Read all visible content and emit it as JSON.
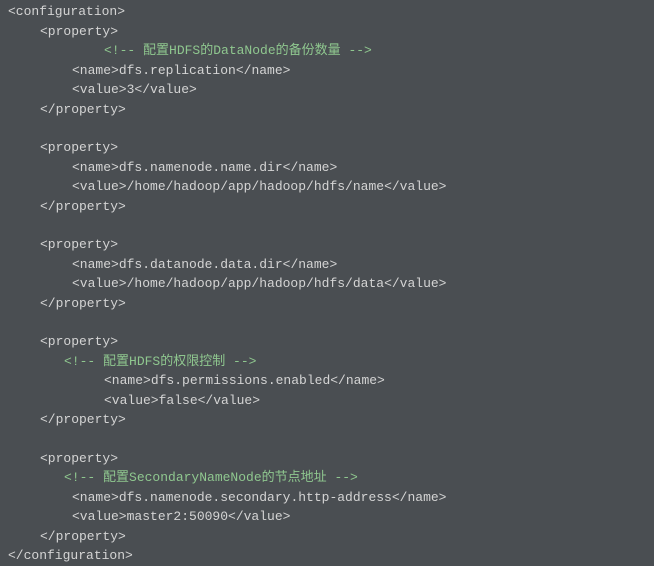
{
  "syntax": {
    "configuration_open": "<configuration>",
    "configuration_close": "</configuration>",
    "property_open": "<property>",
    "property_close": "</property>",
    "name_open": "<name>",
    "name_close": "</name>",
    "value_open": "<value>",
    "value_close": "</value>",
    "comment_open": "<!-- ",
    "comment_close": " -->"
  },
  "blocks": [
    {
      "comment": "配置HDFS的DataNode的备份数量",
      "name": "dfs.replication",
      "value": "3"
    },
    {
      "name": "dfs.namenode.name.dir",
      "value": "/home/hadoop/app/hadoop/hdfs/name"
    },
    {
      "name": "dfs.datanode.data.dir",
      "value": "/home/hadoop/app/hadoop/hdfs/data"
    },
    {
      "comment": "配置HDFS的权限控制",
      "name": "dfs.permissions.enabled",
      "value": "false"
    },
    {
      "comment": "配置SecondaryNameNode的节点地址",
      "name": "dfs.namenode.secondary.http-address",
      "value": "master2:50090"
    }
  ]
}
